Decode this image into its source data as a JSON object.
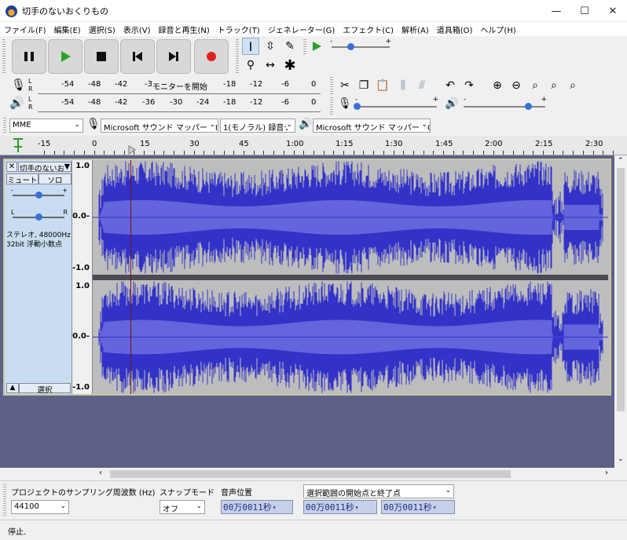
{
  "window": {
    "title": "切手のないおくりもの",
    "minimize": "—",
    "maximize": "☐",
    "close": "✕"
  },
  "menu": [
    "ファイル(F)",
    "編集(E)",
    "選択(S)",
    "表示(V)",
    "録音と再生(N)",
    "トラック(T)",
    "ジェネレーター(G)",
    "エフェクト(C)",
    "解析(A)",
    "道具箱(O)",
    "ヘルプ(H)"
  ],
  "meters": {
    "record_ticks": [
      "-54",
      "-48",
      "-42",
      "-3",
      "モニターを開始",
      "-18",
      "-12",
      "-6",
      "0"
    ],
    "play_ticks": [
      "-54",
      "-48",
      "-42",
      "-36",
      "-30",
      "-24",
      "-18",
      "-12",
      "-6",
      "0"
    ],
    "l": "L",
    "r": "R"
  },
  "slider_signs": {
    "minus": "-",
    "plus": "+"
  },
  "devices": {
    "host": "MME",
    "recording_device": "Microsoft サウンド マッパー - In",
    "channels": "1(モノラル) 録音チ",
    "playback_device": "Microsoft サウンド マッパー - O"
  },
  "timeline": {
    "ticks": [
      "-15",
      "0",
      "15",
      "30",
      "45",
      "1:00",
      "1:15",
      "1:30",
      "1:45",
      "2:00",
      "2:15",
      "2:30"
    ]
  },
  "track": {
    "name": "切手のないお",
    "mute": "ミュート",
    "solo": "ソロ",
    "gain_minus": "-",
    "gain_plus": "+",
    "pan_l": "L",
    "pan_r": "R",
    "info_line1": "ステレオ, 48000Hz",
    "info_line2": "32bit 浮動小数点",
    "select": "選択",
    "collapse": "▲",
    "vruler": [
      "1.0",
      "0.0-",
      "-1.0"
    ]
  },
  "selection_bar": {
    "rate_label": "プロジェクトのサンプリング周波数 (Hz)",
    "rate_value": "44100",
    "snap_label": "スナップモード",
    "snap_value": "オフ",
    "audio_pos_label": "音声位置",
    "audio_pos_value": "00万0011秒",
    "sel_label": "選択範囲の開始点と終了点",
    "sel_start": "00万0011秒",
    "sel_end": "00万0011秒"
  },
  "status": "停止."
}
